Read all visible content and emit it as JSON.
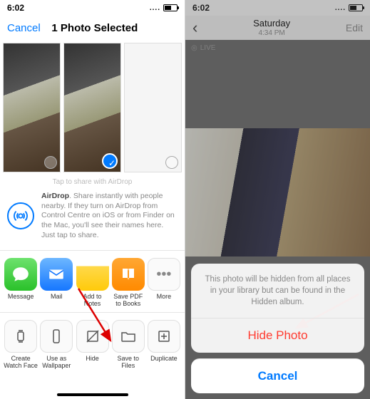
{
  "left": {
    "status_time": "6:02",
    "nav_cancel": "Cancel",
    "nav_title": "1 Photo Selected",
    "airdrop_hint": "Tap to share with AirDrop",
    "airdrop_bold": "AirDrop",
    "airdrop_text": ". Share instantly with people nearby. If they turn on AirDrop from Control Centre on iOS or from Finder on the Mac, you'll see their names here. Just tap to share.",
    "apps": [
      {
        "label": "Message"
      },
      {
        "label": "Mail"
      },
      {
        "label": "Add to Notes"
      },
      {
        "label": "Save PDF to Books"
      },
      {
        "label": "More"
      }
    ],
    "actions": [
      {
        "label": "Create Watch Face"
      },
      {
        "label": "Use as Wallpaper"
      },
      {
        "label": "Hide"
      },
      {
        "label": "Save to Files"
      },
      {
        "label": "Duplicate"
      }
    ]
  },
  "right": {
    "status_time": "6:02",
    "nav_day": "Saturday",
    "nav_time": "4:34 PM",
    "nav_edit": "Edit",
    "live": "LIVE",
    "sheet_msg": "This photo will be hidden from all places in your library but can be found in the Hidden album.",
    "hide_btn": "Hide Photo",
    "cancel_btn": "Cancel"
  }
}
